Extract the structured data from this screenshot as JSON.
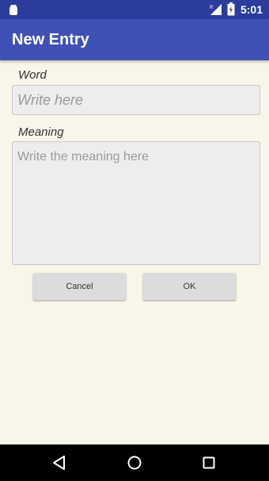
{
  "status_bar": {
    "time": "5:01",
    "icons": [
      "android-icon",
      "signal-icon",
      "battery-icon"
    ]
  },
  "app_bar": {
    "title": "New Entry",
    "color": "#3f51b5"
  },
  "form": {
    "word_label": "Word",
    "word_value": "",
    "word_placeholder": "Write here",
    "meaning_label": "Meaning",
    "meaning_value": "",
    "meaning_placeholder": "Write the meaning here"
  },
  "buttons": {
    "cancel_label": "Cancel",
    "ok_label": "OK"
  },
  "nav_bar": {
    "icons": [
      "back-icon",
      "home-icon",
      "recent-apps-icon"
    ]
  },
  "colors": {
    "status_bar": "#2b3c9c",
    "background": "#f8f5e9",
    "field_background": "#ededed",
    "button_background": "#dcdcdc"
  }
}
